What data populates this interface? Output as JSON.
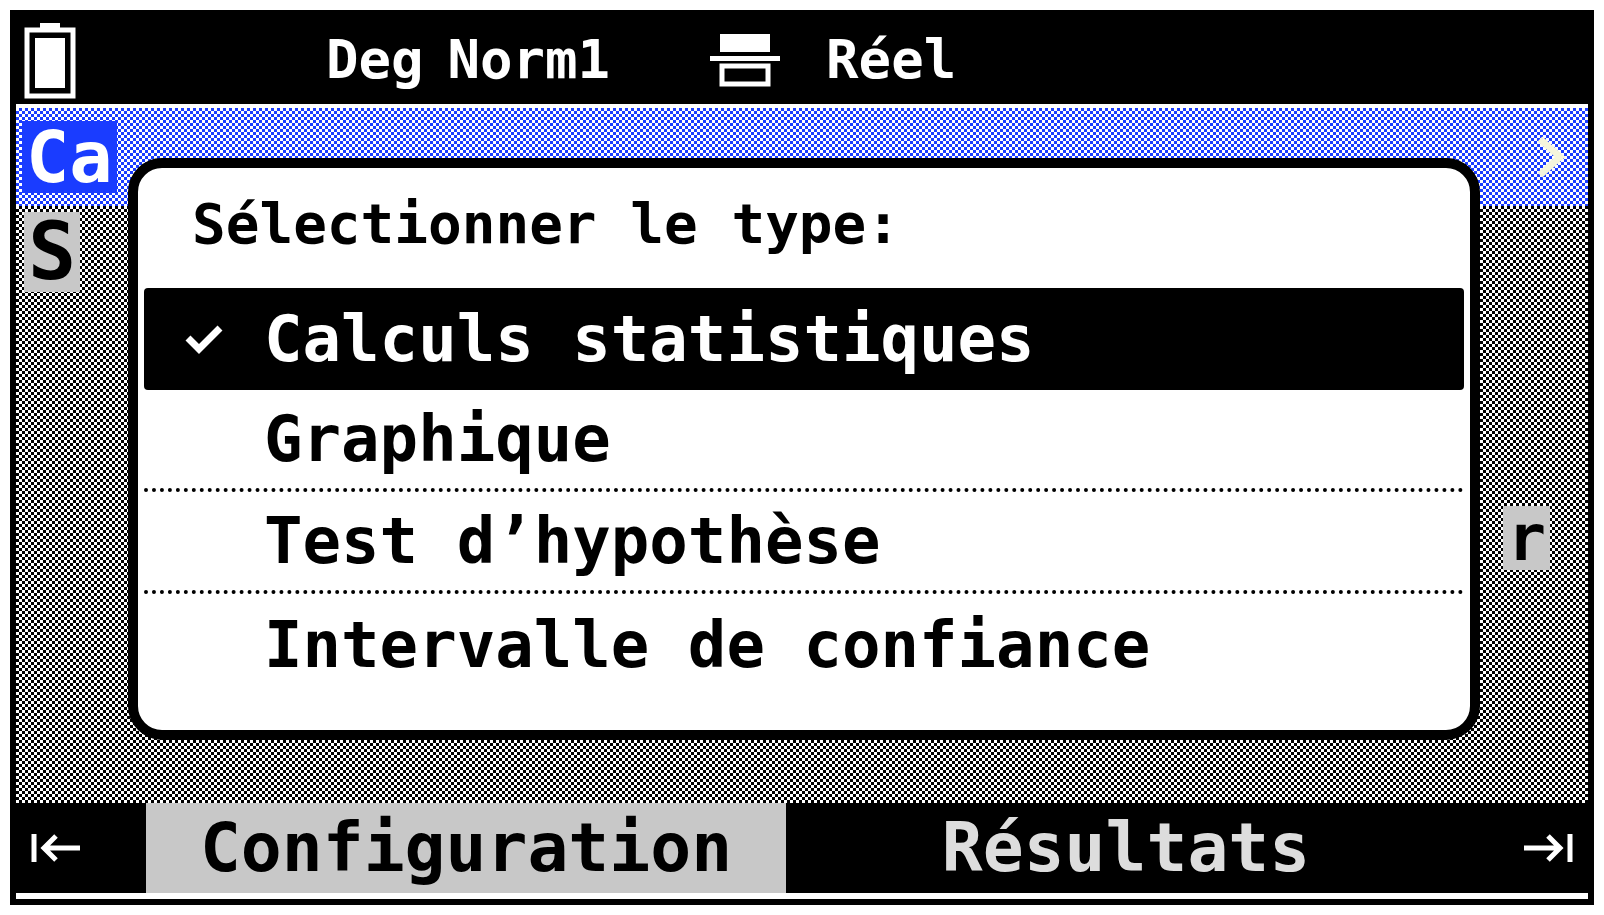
{
  "status_bar": {
    "angle_mode": "Deg",
    "display_format": "Norm1",
    "number_mode": "Réel"
  },
  "background": {
    "title": "Ca",
    "left_text": "S",
    "right_text": "r"
  },
  "tabs": [
    {
      "label": "Configuration",
      "selected": true
    },
    {
      "label": "Résultats",
      "selected": false
    }
  ],
  "dialog": {
    "title": "Sélectionner le type:",
    "options": [
      {
        "label": "Calculs statistiques",
        "selected": true,
        "checked": true
      },
      {
        "label": "Graphique",
        "selected": false,
        "checked": false
      },
      {
        "label": "Test d’hypothèse",
        "selected": false,
        "checked": false
      },
      {
        "label": "Intervalle de confiance",
        "selected": false,
        "checked": false
      }
    ]
  }
}
